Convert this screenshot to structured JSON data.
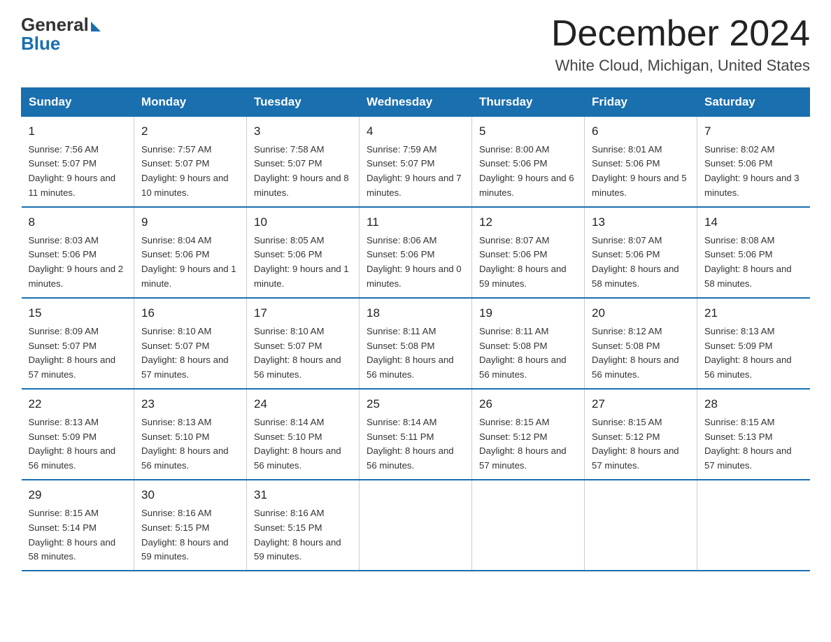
{
  "header": {
    "logo_general": "General",
    "logo_blue": "Blue",
    "month": "December 2024",
    "location": "White Cloud, Michigan, United States"
  },
  "days_of_week": [
    "Sunday",
    "Monday",
    "Tuesday",
    "Wednesday",
    "Thursday",
    "Friday",
    "Saturday"
  ],
  "weeks": [
    [
      {
        "day": "1",
        "sunrise": "Sunrise: 7:56 AM",
        "sunset": "Sunset: 5:07 PM",
        "daylight": "Daylight: 9 hours and 11 minutes."
      },
      {
        "day": "2",
        "sunrise": "Sunrise: 7:57 AM",
        "sunset": "Sunset: 5:07 PM",
        "daylight": "Daylight: 9 hours and 10 minutes."
      },
      {
        "day": "3",
        "sunrise": "Sunrise: 7:58 AM",
        "sunset": "Sunset: 5:07 PM",
        "daylight": "Daylight: 9 hours and 8 minutes."
      },
      {
        "day": "4",
        "sunrise": "Sunrise: 7:59 AM",
        "sunset": "Sunset: 5:07 PM",
        "daylight": "Daylight: 9 hours and 7 minutes."
      },
      {
        "day": "5",
        "sunrise": "Sunrise: 8:00 AM",
        "sunset": "Sunset: 5:06 PM",
        "daylight": "Daylight: 9 hours and 6 minutes."
      },
      {
        "day": "6",
        "sunrise": "Sunrise: 8:01 AM",
        "sunset": "Sunset: 5:06 PM",
        "daylight": "Daylight: 9 hours and 5 minutes."
      },
      {
        "day": "7",
        "sunrise": "Sunrise: 8:02 AM",
        "sunset": "Sunset: 5:06 PM",
        "daylight": "Daylight: 9 hours and 3 minutes."
      }
    ],
    [
      {
        "day": "8",
        "sunrise": "Sunrise: 8:03 AM",
        "sunset": "Sunset: 5:06 PM",
        "daylight": "Daylight: 9 hours and 2 minutes."
      },
      {
        "day": "9",
        "sunrise": "Sunrise: 8:04 AM",
        "sunset": "Sunset: 5:06 PM",
        "daylight": "Daylight: 9 hours and 1 minute."
      },
      {
        "day": "10",
        "sunrise": "Sunrise: 8:05 AM",
        "sunset": "Sunset: 5:06 PM",
        "daylight": "Daylight: 9 hours and 1 minute."
      },
      {
        "day": "11",
        "sunrise": "Sunrise: 8:06 AM",
        "sunset": "Sunset: 5:06 PM",
        "daylight": "Daylight: 9 hours and 0 minutes."
      },
      {
        "day": "12",
        "sunrise": "Sunrise: 8:07 AM",
        "sunset": "Sunset: 5:06 PM",
        "daylight": "Daylight: 8 hours and 59 minutes."
      },
      {
        "day": "13",
        "sunrise": "Sunrise: 8:07 AM",
        "sunset": "Sunset: 5:06 PM",
        "daylight": "Daylight: 8 hours and 58 minutes."
      },
      {
        "day": "14",
        "sunrise": "Sunrise: 8:08 AM",
        "sunset": "Sunset: 5:06 PM",
        "daylight": "Daylight: 8 hours and 58 minutes."
      }
    ],
    [
      {
        "day": "15",
        "sunrise": "Sunrise: 8:09 AM",
        "sunset": "Sunset: 5:07 PM",
        "daylight": "Daylight: 8 hours and 57 minutes."
      },
      {
        "day": "16",
        "sunrise": "Sunrise: 8:10 AM",
        "sunset": "Sunset: 5:07 PM",
        "daylight": "Daylight: 8 hours and 57 minutes."
      },
      {
        "day": "17",
        "sunrise": "Sunrise: 8:10 AM",
        "sunset": "Sunset: 5:07 PM",
        "daylight": "Daylight: 8 hours and 56 minutes."
      },
      {
        "day": "18",
        "sunrise": "Sunrise: 8:11 AM",
        "sunset": "Sunset: 5:08 PM",
        "daylight": "Daylight: 8 hours and 56 minutes."
      },
      {
        "day": "19",
        "sunrise": "Sunrise: 8:11 AM",
        "sunset": "Sunset: 5:08 PM",
        "daylight": "Daylight: 8 hours and 56 minutes."
      },
      {
        "day": "20",
        "sunrise": "Sunrise: 8:12 AM",
        "sunset": "Sunset: 5:08 PM",
        "daylight": "Daylight: 8 hours and 56 minutes."
      },
      {
        "day": "21",
        "sunrise": "Sunrise: 8:13 AM",
        "sunset": "Sunset: 5:09 PM",
        "daylight": "Daylight: 8 hours and 56 minutes."
      }
    ],
    [
      {
        "day": "22",
        "sunrise": "Sunrise: 8:13 AM",
        "sunset": "Sunset: 5:09 PM",
        "daylight": "Daylight: 8 hours and 56 minutes."
      },
      {
        "day": "23",
        "sunrise": "Sunrise: 8:13 AM",
        "sunset": "Sunset: 5:10 PM",
        "daylight": "Daylight: 8 hours and 56 minutes."
      },
      {
        "day": "24",
        "sunrise": "Sunrise: 8:14 AM",
        "sunset": "Sunset: 5:10 PM",
        "daylight": "Daylight: 8 hours and 56 minutes."
      },
      {
        "day": "25",
        "sunrise": "Sunrise: 8:14 AM",
        "sunset": "Sunset: 5:11 PM",
        "daylight": "Daylight: 8 hours and 56 minutes."
      },
      {
        "day": "26",
        "sunrise": "Sunrise: 8:15 AM",
        "sunset": "Sunset: 5:12 PM",
        "daylight": "Daylight: 8 hours and 57 minutes."
      },
      {
        "day": "27",
        "sunrise": "Sunrise: 8:15 AM",
        "sunset": "Sunset: 5:12 PM",
        "daylight": "Daylight: 8 hours and 57 minutes."
      },
      {
        "day": "28",
        "sunrise": "Sunrise: 8:15 AM",
        "sunset": "Sunset: 5:13 PM",
        "daylight": "Daylight: 8 hours and 57 minutes."
      }
    ],
    [
      {
        "day": "29",
        "sunrise": "Sunrise: 8:15 AM",
        "sunset": "Sunset: 5:14 PM",
        "daylight": "Daylight: 8 hours and 58 minutes."
      },
      {
        "day": "30",
        "sunrise": "Sunrise: 8:16 AM",
        "sunset": "Sunset: 5:15 PM",
        "daylight": "Daylight: 8 hours and 59 minutes."
      },
      {
        "day": "31",
        "sunrise": "Sunrise: 8:16 AM",
        "sunset": "Sunset: 5:15 PM",
        "daylight": "Daylight: 8 hours and 59 minutes."
      },
      {
        "day": "",
        "sunrise": "",
        "sunset": "",
        "daylight": ""
      },
      {
        "day": "",
        "sunrise": "",
        "sunset": "",
        "daylight": ""
      },
      {
        "day": "",
        "sunrise": "",
        "sunset": "",
        "daylight": ""
      },
      {
        "day": "",
        "sunrise": "",
        "sunset": "",
        "daylight": ""
      }
    ]
  ]
}
